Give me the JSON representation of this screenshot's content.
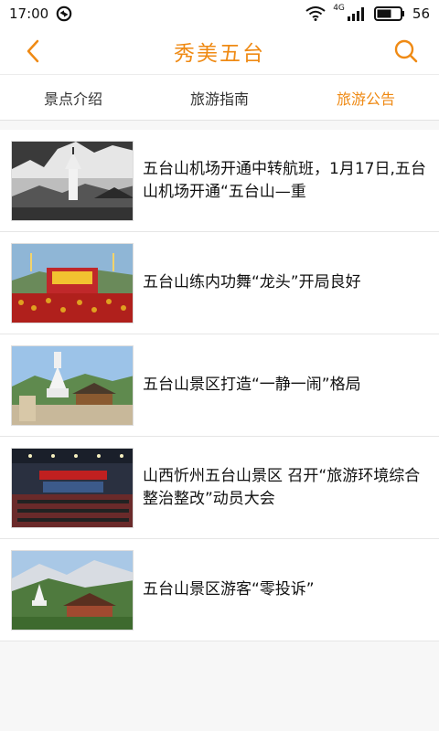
{
  "status_bar": {
    "time": "17:00",
    "network_label": "4G",
    "battery_level": "56"
  },
  "header": {
    "title": "秀美五台",
    "back_icon": "chevron-left-icon",
    "search_icon": "search-icon"
  },
  "tabs": [
    {
      "label": "景点介绍",
      "active": false
    },
    {
      "label": "旅游指南",
      "active": false
    },
    {
      "label": "旅游公告",
      "active": true
    }
  ],
  "news": [
    {
      "title": "五台山机场开通中转航班，1月17日,五台山机场开通“五台山—重",
      "image": "bw-pagoda-photo"
    },
    {
      "title": "五台山练内功舞“龙头”开局良好",
      "image": "stage-ceremony-photo"
    },
    {
      "title": "五台山景区打造“一静一闹”格局",
      "image": "white-stupa-photo"
    },
    {
      "title": "山西忻州五台山景区 召开“旅游环境综合整治整改”动员大会",
      "image": "conference-hall-photo"
    },
    {
      "title": "五台山景区游客“零投诉”",
      "image": "mountain-temple-photo"
    }
  ],
  "colors": {
    "accent": "#ef8a14",
    "background": "#f7f7f7"
  }
}
